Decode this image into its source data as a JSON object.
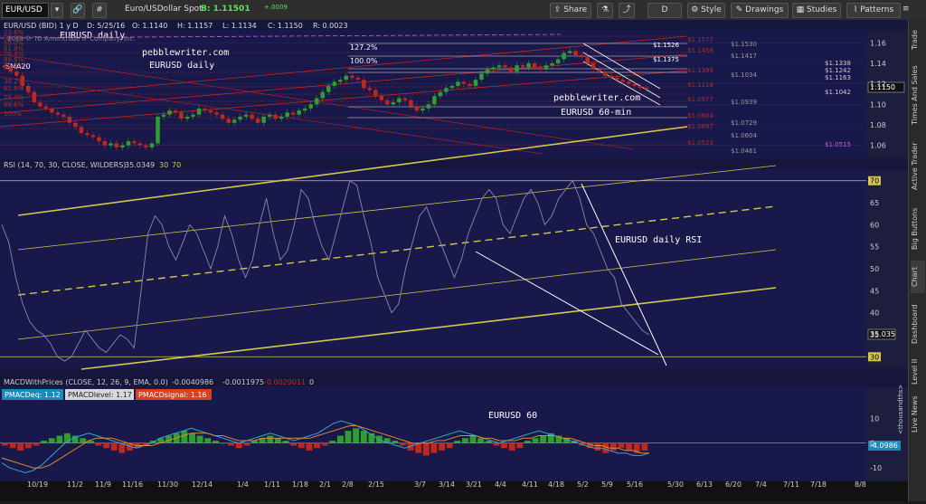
{
  "toolbar": {
    "symbol": "EUR/USD",
    "description": "Euro/USDollar Spot",
    "bid_label": "B: 1.11501",
    "bid_change": "+.0009",
    "share": "Share",
    "drawings": "Drawings",
    "style": "Style",
    "studies": "Studies",
    "patterns": "Patterns",
    "period": "D"
  },
  "price_header": {
    "symbol_period": "EUR/USD (BID) 1 y D",
    "date": "D: 5/25/16",
    "open": "O: 1.1140",
    "high": "H: 1.1157",
    "low": "L: 1.1134",
    "close": "C: 1.1150",
    "range": "R: 0.0023"
  },
  "sidebar_tabs": [
    "Trade",
    "Times And Sales",
    "Active Trader",
    "Big Buttons",
    "Chart",
    "Dashboard",
    "Level II",
    "Live News"
  ],
  "annotations": {
    "copyright": "2016 © TD Ameritrade IP Company, Inc.",
    "eurusd_daily_top": "EURUSD daily",
    "site1": "pebblewriter.com",
    "eurusd_daily_2": "EURUSD daily",
    "site2": "pebblewriter.com",
    "eurusd_60": "EURUSD 60-min",
    "rsi_label": "EURUSD daily RSI",
    "macd_label": "EURUSD 60",
    "pct127": "127.2%",
    "pct100": "100.0%",
    "sma20": "SMA20"
  },
  "price_levels_red": [
    "$1.1577",
    "$1.1458",
    "$1.1399",
    "$1.1118",
    "$1.0977",
    "$1.0804",
    "$1.0697",
    "$1.0523"
  ],
  "price_levels_gray": [
    "$1.1530",
    "$1.1417",
    "$1.1034",
    "$1.0939",
    "$1.0729",
    "$1.0604",
    "$1.0461"
  ],
  "price_levels_white": [
    "$1.1526",
    "$1.1375"
  ],
  "price_levels_right": [
    "$1.1338",
    "$1.1242",
    "$1.1163",
    "$1.1042",
    "$1.0515"
  ],
  "left_fibs": [
    "23.6%",
    "38.2%",
    "50.0%",
    "61.8%",
    "76.4%",
    "88.6%",
    "23.6%",
    "38.2%",
    "61.8%",
    "76.4%",
    "88.6%",
    "100%"
  ],
  "rsi_header": {
    "study": "RSI (14, 70, 30, CLOSE, WILDERS)",
    "value": "35.0349",
    "ob": "30",
    "os": "70"
  },
  "macd_header": {
    "study": "MACDWithPrices (CLOSE, 12, 26, 9, EMA, 0.0)",
    "v1": "-0.0040986",
    "v2": "-0.0011975",
    "v3": "-0.0029011",
    "v4": "0",
    "deq_label": "PMACDeq: 1.12",
    "level_label": "PMACDlevel: 1.17",
    "signal_label": "PMACDsignal: 1.16"
  },
  "current_price_tag": "1.1150",
  "rsi_value_tag": "35.035",
  "macd_value_tag": "-4.0986",
  "macd_axis_unit": "<thousandths>",
  "colors": {
    "bg": "#16163c",
    "up": "#2e9e2e",
    "down": "#c0281e",
    "rsi_line": "#8a8aa8",
    "channel": "#d4c84a",
    "fib_red": "#c0281e",
    "white": "#ffffff"
  },
  "chart_data": [
    {
      "type": "candlestick",
      "title": "EUR/USD (BID) 1 y D",
      "yticks": [
        1.06,
        1.08,
        1.1,
        1.12,
        1.14,
        1.16
      ],
      "ylim": [
        1.05,
        1.17
      ],
      "xtick_labels": [
        "10/19",
        "11/2",
        "11/9",
        "11/16",
        "11/30",
        "12/14",
        "1/4",
        "1/11",
        "1/18",
        "2/1",
        "2/8",
        "2/15",
        "3/7",
        "3/14",
        "3/21",
        "4/4",
        "4/11",
        "4/18",
        "5/2",
        "5/9",
        "5/16",
        "5/30",
        "6/13",
        "6/20",
        "7/4",
        "7/11",
        "7/18",
        "8/8"
      ],
      "close_series": [
        1.136,
        1.132,
        1.128,
        1.118,
        1.112,
        1.102,
        1.098,
        1.096,
        1.092,
        1.09,
        1.088,
        1.082,
        1.078,
        1.072,
        1.07,
        1.068,
        1.064,
        1.06,
        1.062,
        1.058,
        1.06,
        1.064,
        1.062,
        1.06,
        1.058,
        1.062,
        1.088,
        1.09,
        1.094,
        1.092,
        1.086,
        1.088,
        1.09,
        1.096,
        1.094,
        1.092,
        1.09,
        1.086,
        1.082,
        1.085,
        1.088,
        1.09,
        1.086,
        1.082,
        1.088,
        1.09,
        1.086,
        1.088,
        1.092,
        1.09,
        1.094,
        1.096,
        1.1,
        1.106,
        1.112,
        1.118,
        1.122,
        1.124,
        1.128,
        1.126,
        1.124,
        1.116,
        1.114,
        1.108,
        1.104,
        1.1,
        1.102,
        1.106,
        1.104,
        1.098,
        1.094,
        1.096,
        1.1,
        1.108,
        1.112,
        1.116,
        1.118,
        1.122,
        1.12,
        1.118,
        1.124,
        1.13,
        1.134,
        1.136,
        1.138,
        1.136,
        1.132,
        1.138,
        1.136,
        1.14,
        1.136,
        1.134,
        1.138,
        1.14,
        1.144,
        1.15,
        1.152,
        1.148,
        1.146,
        1.14,
        1.134,
        1.132,
        1.128,
        1.126,
        1.124,
        1.122,
        1.12,
        1.118,
        1.116,
        1.115
      ]
    },
    {
      "type": "line",
      "title": "RSI (14, 70, 30, CLOSE, WILDERS)",
      "yticks": [
        30,
        35,
        40,
        45,
        50,
        55,
        60,
        65,
        70
      ],
      "ylim": [
        28,
        72
      ],
      "values": [
        60,
        56,
        48,
        42,
        38,
        36,
        35,
        33,
        30,
        29,
        30,
        33,
        36,
        34,
        32,
        31,
        33,
        35,
        34,
        32,
        45,
        58,
        62,
        60,
        55,
        52,
        56,
        60,
        58,
        54,
        50,
        55,
        62,
        58,
        52,
        48,
        52,
        60,
        66,
        58,
        52,
        54,
        60,
        68,
        66,
        60,
        55,
        52,
        58,
        64,
        70,
        69,
        62,
        56,
        48,
        44,
        40,
        42,
        50,
        56,
        62,
        64,
        60,
        56,
        52,
        48,
        52,
        58,
        62,
        66,
        68,
        66,
        60,
        58,
        62,
        66,
        68,
        65,
        60,
        62,
        66,
        68,
        70,
        66,
        60,
        58,
        54,
        50,
        48,
        42,
        40,
        38,
        36,
        35
      ]
    },
    {
      "type": "bar",
      "title": "MACDWithPrices (CLOSE, 12, 26, 9, EMA, 0.0)",
      "ylabel": "<thousandths>",
      "yticks": [
        -10,
        0,
        10
      ],
      "ylim": [
        -14,
        16
      ],
      "histogram": [
        -1,
        -2,
        -3,
        -2,
        -1,
        1,
        2,
        3,
        4,
        3,
        2,
        1,
        -1,
        -2,
        -3,
        -4,
        -3,
        -2,
        -1,
        1,
        2,
        3,
        4,
        5,
        4,
        3,
        2,
        1,
        0,
        -1,
        -2,
        -1,
        1,
        2,
        3,
        2,
        1,
        -1,
        -2,
        -3,
        -2,
        -1,
        1,
        3,
        5,
        6,
        5,
        4,
        3,
        2,
        1,
        -1,
        -3,
        -4,
        -5,
        -4,
        -3,
        -2,
        1,
        2,
        3,
        2,
        1,
        -1,
        -2,
        -3,
        -2,
        1,
        2,
        3,
        4,
        3,
        2,
        1,
        -1,
        -2,
        -3,
        -4,
        -3,
        -2,
        -3,
        -4,
        -3
      ],
      "macd_line": [
        -8,
        -10,
        -11,
        -12,
        -11,
        -9,
        -6,
        -3,
        0,
        2,
        3,
        4,
        3,
        2,
        1,
        0,
        -1,
        -2,
        -1,
        0,
        2,
        3,
        4,
        5,
        6,
        5,
        4,
        3,
        2,
        1,
        0,
        1,
        2,
        3,
        4,
        3,
        2,
        1,
        2,
        3,
        4,
        6,
        8,
        9,
        8,
        7,
        5,
        3,
        1,
        0,
        -1,
        -2,
        -1,
        0,
        1,
        2,
        3,
        4,
        5,
        4,
        3,
        2,
        1,
        0,
        1,
        2,
        3,
        4,
        5,
        4,
        3,
        2,
        1,
        0,
        -1,
        -2,
        -2,
        -3,
        -4,
        -4,
        -5,
        -5,
        -4
      ],
      "signal_line": [
        -6,
        -7,
        -8,
        -9,
        -10,
        -10,
        -9,
        -7,
        -5,
        -3,
        -1,
        1,
        2,
        2,
        2,
        1,
        0,
        -1,
        -1,
        -1,
        0,
        1,
        2,
        3,
        4,
        4,
        4,
        3,
        3,
        2,
        1,
        1,
        1,
        2,
        2,
        2,
        2,
        2,
        2,
        2,
        3,
        4,
        5,
        6,
        7,
        7,
        6,
        5,
        4,
        3,
        2,
        1,
        0,
        0,
        0,
        1,
        1,
        2,
        3,
        3,
        3,
        2,
        2,
        1,
        1,
        1,
        2,
        2,
        3,
        3,
        3,
        2,
        2,
        1,
        0,
        -1,
        -1,
        -2,
        -2,
        -3,
        -3,
        -4,
        -4
      ]
    }
  ]
}
